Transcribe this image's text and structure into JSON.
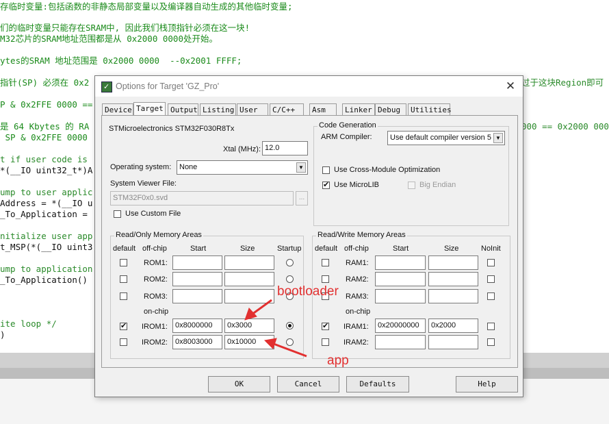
{
  "background": {
    "lines": [
      "存临时变量:包括函数的非静态局部变量以及编译器自动生成的其他临时变量;",
      "",
      "们的临时变量只能存在SRAM中, 因此我们栈顶指针必须在这一块!",
      "M32芯片的SRAM地址范围都是从 0x2000 0000处开始。",
      "",
      "ytes的SRAM 地址范围是 0x2000 0000  --0x2001 FFFF;",
      "",
      "指针(SP) 必须在 0x2",
      "",
      "P & 0x2FFE 0000 ==",
      "",
      "是 64 Kbytes 的 RA",
      " SP & 0x2FFE 0000",
      "",
      "t if user code is",
      "*(__IO uint32_t*)A",
      "",
      "ump to user applic",
      "Address = *(__IO u",
      "_To_Application =",
      "",
      "nitialize user app",
      "t_MSP(*(__IO uint3",
      "",
      "ump to application",
      "_To_Application()",
      "",
      "",
      "",
      "ite loop */",
      ")"
    ],
    "right_lines": [
      "过于这块Region即可",
      "",
      "",
      "",
      "000 == 0x2000 000"
    ]
  },
  "dialog": {
    "title": "Options for Target 'GZ_Pro'",
    "close_label": "✕",
    "tabs": [
      "Device",
      "Target",
      "Output",
      "Listing",
      "User",
      "C/C++",
      "Asm",
      "Linker",
      "Debug",
      "Utilities"
    ],
    "active_tab": "Target",
    "device_name": "STMicroelectronics STM32F030R8Tx",
    "xtal_label": "Xtal (MHz):",
    "xtal_value": "12.0",
    "os_label": "Operating system:",
    "os_value": "None",
    "svd_label": "System Viewer File:",
    "svd_value": "STM32F0x0.svd",
    "svd_browse": "...",
    "custom_file_label": "Use Custom File",
    "code_gen": {
      "title": "Code Generation",
      "compiler_label": "ARM Compiler:",
      "compiler_value": "Use default compiler version 5",
      "cross_module_label": "Use Cross-Module Optimization",
      "microlib_label": "Use MicroLIB",
      "big_endian_label": "Big Endian"
    },
    "ro_memory": {
      "title": "Read/Only Memory Areas",
      "headers": {
        "default": "default",
        "offchip": "off-chip",
        "start": "Start",
        "size": "Size",
        "startup": "Startup"
      },
      "onchip_label": "on-chip",
      "rows": [
        {
          "name": "ROM1:",
          "start": "",
          "size": "",
          "default": false,
          "startup": false
        },
        {
          "name": "ROM2:",
          "start": "",
          "size": "",
          "default": false,
          "startup": false
        },
        {
          "name": "ROM3:",
          "start": "",
          "size": "",
          "default": false,
          "startup": false
        },
        {
          "name": "IROM1:",
          "start": "0x8000000",
          "size": "0x3000",
          "default": true,
          "startup": true
        },
        {
          "name": "IROM2:",
          "start": "0x8003000",
          "size": "0x10000",
          "default": false,
          "startup": false
        }
      ]
    },
    "rw_memory": {
      "title": "Read/Write Memory Areas",
      "headers": {
        "default": "default",
        "offchip": "off-chip",
        "start": "Start",
        "size": "Size",
        "noinit": "NoInit"
      },
      "onchip_label": "on-chip",
      "rows": [
        {
          "name": "RAM1:",
          "start": "",
          "size": "",
          "default": false,
          "noinit": false
        },
        {
          "name": "RAM2:",
          "start": "",
          "size": "",
          "default": false,
          "noinit": false
        },
        {
          "name": "RAM3:",
          "start": "",
          "size": "",
          "default": false,
          "noinit": false
        },
        {
          "name": "IRAM1:",
          "start": "0x20000000",
          "size": "0x2000",
          "default": true,
          "noinit": false
        },
        {
          "name": "IRAM2:",
          "start": "",
          "size": "",
          "default": false,
          "noinit": false
        }
      ]
    },
    "buttons": {
      "ok": "OK",
      "cancel": "Cancel",
      "defaults": "Defaults",
      "help": "Help"
    }
  },
  "annotations": {
    "bootloader": "bootloader",
    "app": "app",
    "color": "#e23030"
  }
}
